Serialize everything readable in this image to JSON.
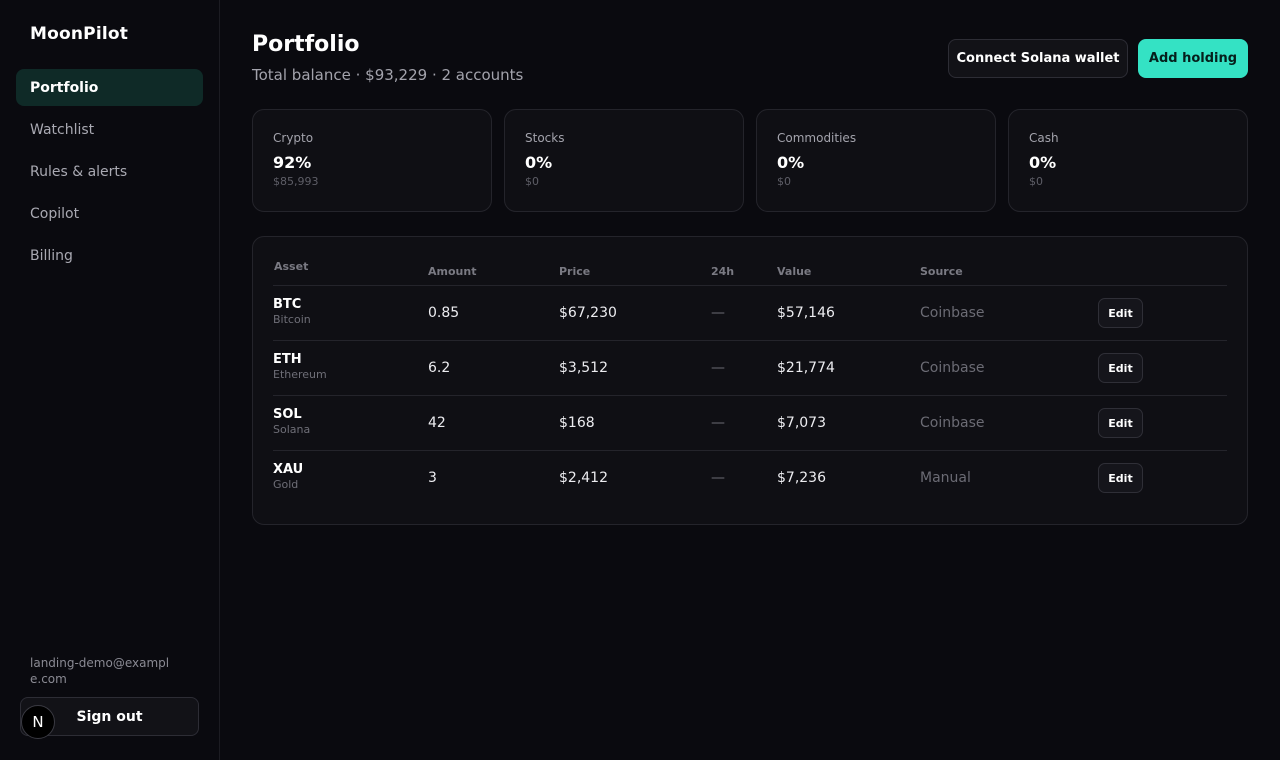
{
  "sidebar": {
    "brand": "MoonPilot",
    "items": [
      {
        "label": "Portfolio",
        "active": true
      },
      {
        "label": "Watchlist",
        "active": false
      },
      {
        "label": "Rules & alerts",
        "active": false
      },
      {
        "label": "Copilot",
        "active": false
      },
      {
        "label": "Billing",
        "active": false
      }
    ],
    "user_email": "landing-demo@example.com",
    "signout_label": "Sign out",
    "badge_letter": "N"
  },
  "header": {
    "title": "Portfolio",
    "subtitle": "Total balance · $93,229 · 2 accounts",
    "connect_label": "Connect Solana wallet",
    "add_label": "Add holding"
  },
  "allocation": [
    {
      "label": "Crypto",
      "percent": "92%",
      "amount": "$85,993"
    },
    {
      "label": "Stocks",
      "percent": "0%",
      "amount": "$0"
    },
    {
      "label": "Commodities",
      "percent": "0%",
      "amount": "$0"
    },
    {
      "label": "Cash",
      "percent": "0%",
      "amount": "$0"
    }
  ],
  "table": {
    "columns": [
      "Asset",
      "Amount",
      "Price",
      "24h",
      "Value",
      "Source"
    ],
    "rows": [
      {
        "symbol": "BTC",
        "name": "Bitcoin",
        "amount": "0.85",
        "price": "$67,230",
        "change": "—",
        "value": "$57,146",
        "source": "Coinbase",
        "action": "Edit"
      },
      {
        "symbol": "ETH",
        "name": "Ethereum",
        "amount": "6.2",
        "price": "$3,512",
        "change": "—",
        "value": "$21,774",
        "source": "Coinbase",
        "action": "Edit"
      },
      {
        "symbol": "SOL",
        "name": "Solana",
        "amount": "42",
        "price": "$168",
        "change": "—",
        "value": "$7,073",
        "source": "Coinbase",
        "action": "Edit"
      },
      {
        "symbol": "XAU",
        "name": "Gold",
        "amount": "3",
        "price": "$2,412",
        "change": "—",
        "value": "$7,236",
        "source": "Manual",
        "action": "Edit"
      }
    ]
  },
  "colors": {
    "accent": "#34e2c4",
    "background": "#0a0a0f",
    "active_nav": "#0f2a27"
  }
}
